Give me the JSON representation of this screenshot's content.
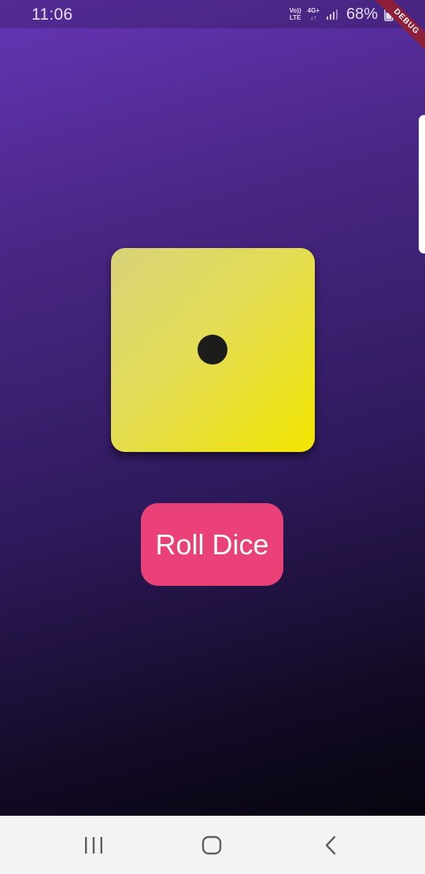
{
  "status_bar": {
    "time": "11:06",
    "volte_top": "Vo))",
    "volte_bottom": "LTE",
    "net_top": "4G+",
    "net_bottom": "↓↑",
    "battery": "68%",
    "debug_banner": "DEBUG",
    "icons": [
      "volte-icon",
      "network-4g-icon",
      "signal-icon",
      "battery-icon"
    ]
  },
  "dice": {
    "value": 1,
    "colors": {
      "face_light": "#d8d37a",
      "face_dark": "#f2e600",
      "pip": "#1c1c1a"
    }
  },
  "roll_button": {
    "label": "Roll Dice",
    "color": "#ea4179"
  },
  "theme": {
    "background_top": "#6535b6",
    "background_bottom": "#030206"
  },
  "nav_bar": {
    "icons": [
      "recent-apps-icon",
      "home-icon",
      "back-icon"
    ]
  }
}
